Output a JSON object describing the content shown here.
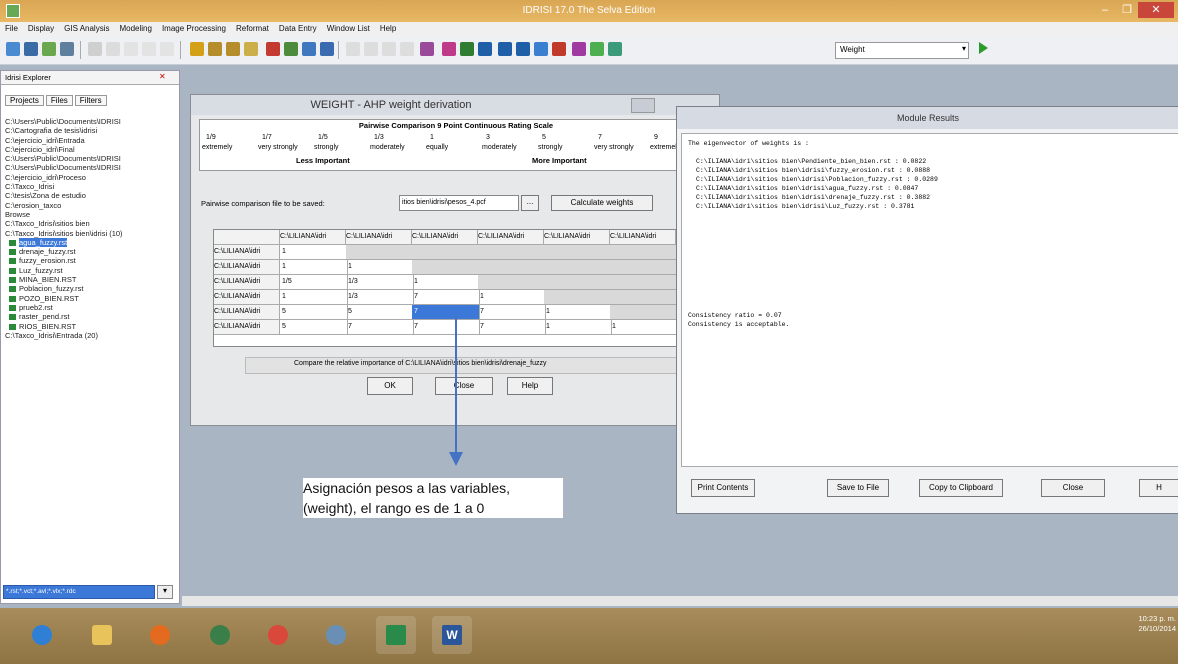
{
  "window": {
    "title": "IDRISI 17.0   The Selva Edition"
  },
  "menu": [
    "File",
    "Display",
    "GIS Analysis",
    "Modeling",
    "Image Processing",
    "Reformat",
    "Data Entry",
    "Window List",
    "Help"
  ],
  "toolbar": {
    "combo_value": "Weight"
  },
  "explorer": {
    "title": "Idrisi Explorer",
    "tabs": [
      "Projects",
      "Files",
      "Filters"
    ],
    "items": [
      "C:\\Users\\Public\\Documents\\IDRISI",
      "C:\\Cartografia de tesis\\idrisi",
      "C:\\ejercicio_idri\\Entrada",
      "C:\\ejercicio_idri\\Final",
      "C:\\Users\\Public\\Documents\\IDRISI",
      "C:\\Users\\Public\\Documents\\IDRISI",
      "C:\\ejercicio_idri\\Proceso",
      "C:\\Taxco_Idrisi",
      "C:\\tesis\\Zona de estudio",
      "C:\\erosion_taxco",
      "Browse",
      "C:\\Taxco_Idrisi\\sitios bien",
      "C:\\Taxco_Idrisi\\sitios bien\\idrisi (10)",
      "agua_fuzzy.rst",
      "drenaje_fuzzy.rst",
      "fuzzy_erosion.rst",
      "Luz_fuzzy.rst",
      "MINA_BIEN.RST",
      "Poblacion_fuzzy.rst",
      "POZO_BIEN.RST",
      "prueb2.rst",
      "raster_pend.rst",
      "RIOS_BIEN.RST",
      "C:\\Taxco_Idrisi\\Entrada (20)"
    ],
    "selected_index": 13,
    "bottom_value": "*.rst;*.vct;*.avl;*.vlx;*.rdc"
  },
  "weight_dialog": {
    "title": "WEIGHT - AHP weight derivation",
    "scale_title": "Pairwise Comparison 9 Point Continuous Rating Scale",
    "scale_values": [
      "1/9",
      "1/7",
      "1/5",
      "1/3",
      "1",
      "3",
      "5",
      "7",
      "9"
    ],
    "scale_words": [
      "extremely",
      "very strongly",
      "strongly",
      "moderately",
      "equally",
      "moderately",
      "strongly",
      "very strongly",
      "extremely"
    ],
    "less_label": "Less Important",
    "more_label": "More Important",
    "file_label": "Pairwise comparison file to be saved:",
    "file_value": "itios bien\\idrisi\\pesos_4.pcf",
    "browse_label": "...",
    "calc_label": "Calculate weights",
    "col_header": "C:\\LILIANA\\idri",
    "matrix": [
      [
        "1",
        "",
        "",
        "",
        "",
        ""
      ],
      [
        "1",
        "1",
        "",
        "",
        "",
        ""
      ],
      [
        "1/5",
        "1/3",
        "1",
        "",
        "",
        ""
      ],
      [
        "1",
        "1/3",
        "7",
        "1",
        "",
        ""
      ],
      [
        "5",
        "5",
        "7",
        "7",
        "1",
        ""
      ],
      [
        "5",
        "7",
        "7",
        "7",
        "1",
        "1"
      ]
    ],
    "selected_cell": [
      4,
      2
    ],
    "hint": "Compare the relative importance of C:\\LILIANA\\idri\\sitios bien\\idrisi\\drenaje_fuzzy",
    "ok": "OK",
    "close": "Close",
    "help": "Help"
  },
  "module_results": {
    "title": "Module Results",
    "lines": [
      "The eigenvector of weights is :",
      "",
      "C:\\ILIANA\\idri\\sitios bien\\Pendiente_bien_bien.rst : 0.0822",
      "C:\\ILIANA\\idri\\sitios bien\\idrisi\\fuzzy_erosion.rst : 0.0888",
      "C:\\ILIANA\\idri\\sitios bien\\idrisi\\Poblacion_fuzzy.rst : 0.0289",
      "C:\\ILIANA\\idri\\sitios bien\\idrisi\\agua_fuzzy.rst : 0.0847",
      "C:\\ILIANA\\idri\\sitios bien\\idrisi\\drenaje_fuzzy.rst : 0.3882",
      "C:\\ILIANA\\idri\\sitios bien\\idrisi\\Luz_fuzzy.rst : 0.3781"
    ],
    "consistency": [
      "Consistency ratio =  0.07",
      "Consistency is acceptable."
    ],
    "buttons": [
      "Print Contents",
      "Save to File",
      "Copy to Clipboard",
      "Close",
      "H"
    ]
  },
  "annotation": {
    "text": "Asignación pesos a las variables,(weight), el rango es de 1 a 0"
  },
  "taskbar": {
    "time": "10:23 p. m.",
    "date": "26/10/2014",
    "word_label": "W"
  },
  "colors": {
    "title_orange": "#e0aa5a",
    "select_blue": "#3b78d8",
    "arrow_blue": "#4472c4"
  }
}
